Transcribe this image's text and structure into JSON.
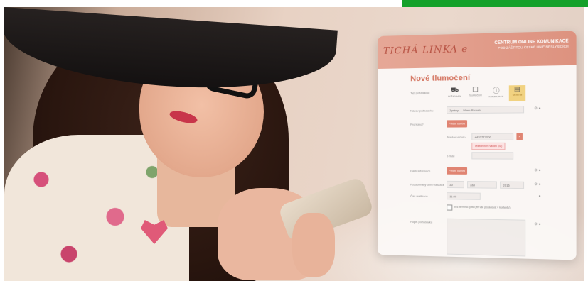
{
  "panel": {
    "logo": "TICHÁ LINKA e",
    "header_title": "CENTRUM ONLINE KOMUNIKACE",
    "header_sub": "POD ZÁŠTITOU ČESKÉ UNIE NESLYŠÍCÍCH",
    "form_title": "Nové tlumočení",
    "type_label": "Typ požadavku",
    "types": [
      "POŽADAVEK",
      "TLUMOČENÍ",
      "KONZULTACE",
      "OSTATNÍ"
    ],
    "name_label": "Název požadavku",
    "name_value": "Zprávy — Mimo Rozvrh",
    "for_whom_label": "Pro koho?",
    "for_whom_button": "Přidat osobu",
    "number_label": "Telefonní číslo",
    "number_value": "+420777000",
    "number_error": "Telefon není validní (cz)",
    "email_label": "e-mail",
    "other_label": "Další informace",
    "other_button": "Přidat osobu",
    "date_label": "Požadovaný den realizace",
    "date_values": [
      "30",
      "září",
      "2015"
    ],
    "time_label": "Čas realizace",
    "time_value": "11:00",
    "checkbox_label": "Bez termínu: (chci jen vše požadovat v kontextu)",
    "detail_label": "Popis požadavku"
  },
  "colors": {
    "accent": "#dd8e7a",
    "title": "#d4715c",
    "active_type": "#f2d27c",
    "top_green": "#14a12a"
  }
}
